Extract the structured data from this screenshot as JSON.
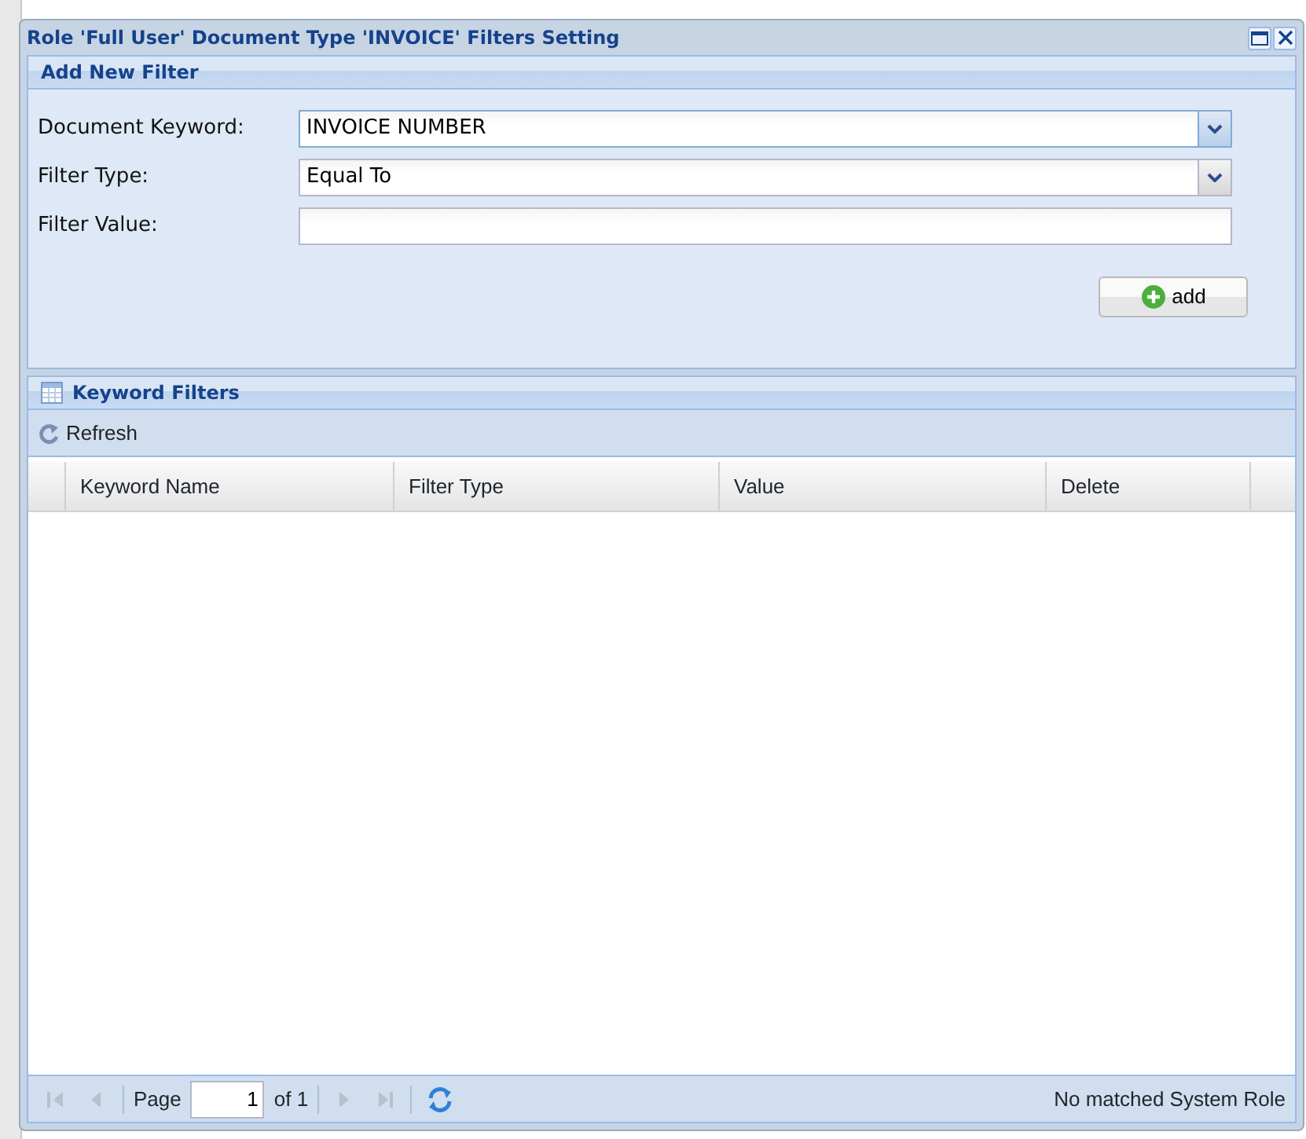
{
  "window": {
    "title": "Role 'Full User' Document Type 'INVOICE' Filters Setting"
  },
  "add_filter": {
    "title": "Add New Filter",
    "fields": [
      {
        "kind": "combo",
        "label": "Document Keyword:",
        "value": "INVOICE NUMBER",
        "focused": true
      },
      {
        "kind": "combo",
        "label": "Filter Type:",
        "value": "Equal To",
        "focused": false
      },
      {
        "kind": "text",
        "label": "Filter Value:",
        "focused": false
      }
    ],
    "button": "add"
  },
  "grid": {
    "title": "Keyword Filters",
    "toolbar": [
      "Refresh"
    ],
    "columns": [
      "Keyword Name",
      "Filter Type",
      "Value",
      "Delete"
    ],
    "paging": {
      "page_label": "Page",
      "page": "1",
      "of": "of 1",
      "status": "No matched System Role",
      "buttons": [
        {
          "kind": "first",
          "disabled": true
        },
        {
          "kind": "prev",
          "disabled": true
        },
        {
          "kind": "next",
          "disabled": true
        },
        {
          "kind": "last",
          "disabled": true
        }
      ]
    }
  }
}
